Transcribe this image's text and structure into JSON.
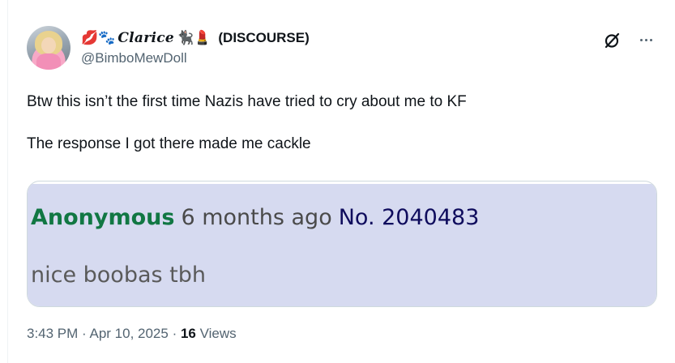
{
  "author": {
    "display_name_prefix_emojis": "💋🐾",
    "display_name_script": "Clarice",
    "display_name_suffix_emojis": "🐈‍⬛💄",
    "display_name_tag": "(DISCOURSE)",
    "handle": "@BimboMewDoll",
    "avatar_icon": "avatar-photo"
  },
  "tweet": {
    "text": "Btw this isn’t the first time Nazis have tried to cry about me to KF\n\nThe response I got there made me cackle"
  },
  "embedded_post": {
    "name": "Anonymous",
    "time": "6 months ago",
    "number": "No. 2040483",
    "body": "nice boobas tbh",
    "name_color": "#117743",
    "background_color": "#d6daf0"
  },
  "meta": {
    "time": "3:43 PM",
    "separator1": " · ",
    "date": "Apr 10, 2025",
    "separator2": " · ",
    "views_count": "16",
    "views_label": " Views"
  },
  "actions": {
    "grok_icon": "grok-icon",
    "more_icon": "more-icon"
  }
}
